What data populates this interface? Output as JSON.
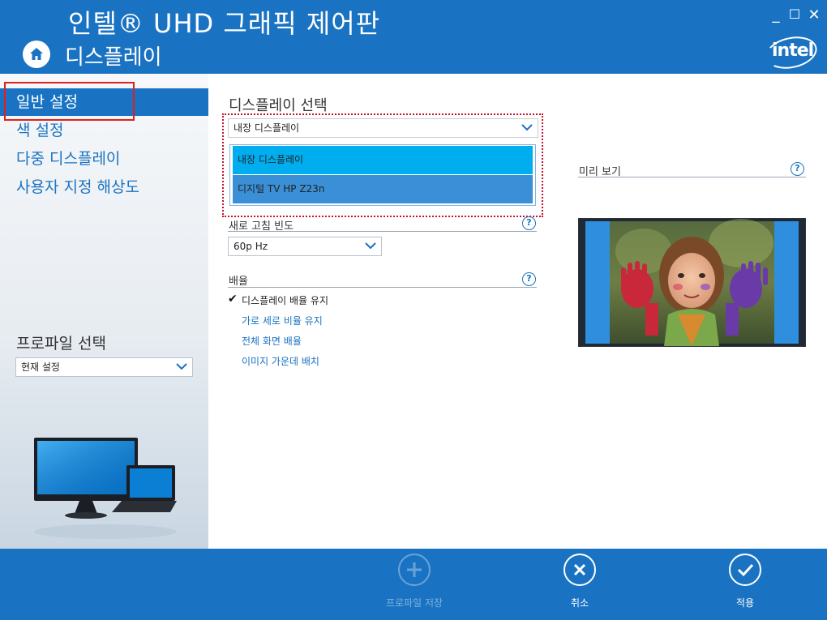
{
  "header": {
    "app_title": "인텔® UHD 그래픽 제어판",
    "page_title": "디스플레이",
    "win_minimize": "_",
    "win_maximize": "☐",
    "win_close": "✕",
    "logo_text": "intel"
  },
  "sidebar": {
    "items": [
      {
        "label": "일반 설정",
        "active": true
      },
      {
        "label": "색 설정",
        "active": false
      },
      {
        "label": "다중 디스플레이",
        "active": false
      },
      {
        "label": "사용자 지정 해상도",
        "active": false
      }
    ],
    "profile_label": "프로파일 선택",
    "profile_value": "현재 설정"
  },
  "main": {
    "display_select_label": "디스플레이 선택",
    "display_select_value": "내장 디스플레이",
    "display_options": [
      "내장 디스플레이",
      "디지털 TV HP Z23n"
    ],
    "refresh_label": "새로 고침 빈도",
    "refresh_value": "60p Hz",
    "scaling_label": "배율",
    "scaling_options": [
      {
        "label": "디스플레이 배율 유지",
        "checked": true
      },
      {
        "label": "가로 세로 비율 유지",
        "checked": false
      },
      {
        "label": "전체 화면 배율",
        "checked": false
      },
      {
        "label": "이미지 가운데 배치",
        "checked": false
      }
    ],
    "preview_label": "미리 보기",
    "help_glyph": "?"
  },
  "bottombar": {
    "save_profile": "프로파일 저장",
    "cancel": "취소",
    "apply": "적용"
  },
  "colors": {
    "brand_blue": "#1a73c2",
    "list_selected": "#00aeef",
    "list_hover": "#3a8fd6",
    "highlight_red": "#e02020"
  }
}
